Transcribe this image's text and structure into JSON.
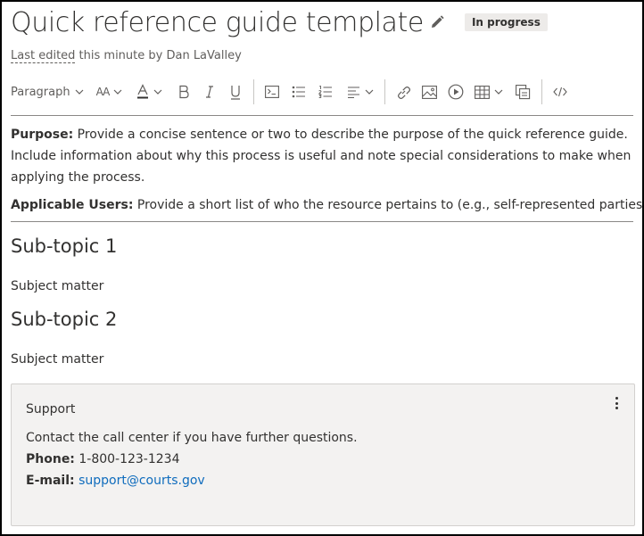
{
  "page": {
    "title": "Quick reference guide template",
    "status": "In progress",
    "last_edited_link": "Last edited",
    "last_edited_rest": " this minute by Dan LaValley"
  },
  "toolbar": {
    "paragraph_label": "Paragraph",
    "font_size_label": "AA"
  },
  "content": {
    "purpose_label": "Purpose:",
    "purpose_text": " Provide a concise sentence or two to describe the purpose of the quick reference guide. Include information about why this process is useful and note special considerations to make when applying the process.",
    "users_label": "Applicable Users:",
    "users_text": " Provide a short list of who the resource pertains to (e.g., self-represented parties, etc.)",
    "sections": [
      {
        "heading": "Sub-topic 1",
        "body": "Subject matter"
      },
      {
        "heading": "Sub-topic 2",
        "body": "Subject matter"
      }
    ]
  },
  "support": {
    "title": "Support",
    "line": "Contact the call center if you have further questions.",
    "phone_label": "Phone:",
    "phone": " 1-800-123-1234",
    "email_label": "E-mail:",
    "email": "support@courts.gov"
  },
  "colors": {
    "text": "#323130",
    "muted": "#605e5c",
    "link": "#0f6cbd",
    "badge_bg": "#edebe9",
    "card_bg": "#f3f2f1"
  },
  "icons": [
    "edit-pencil-icon",
    "chevron-down-icon",
    "font-color-icon",
    "bold-icon",
    "italic-icon",
    "underline-icon",
    "code-block-icon",
    "bulleted-list-icon",
    "numbered-list-icon",
    "align-icon",
    "link-icon",
    "image-icon",
    "video-icon",
    "table-icon",
    "copy-icon",
    "html-code-icon",
    "more-options-icon"
  ]
}
